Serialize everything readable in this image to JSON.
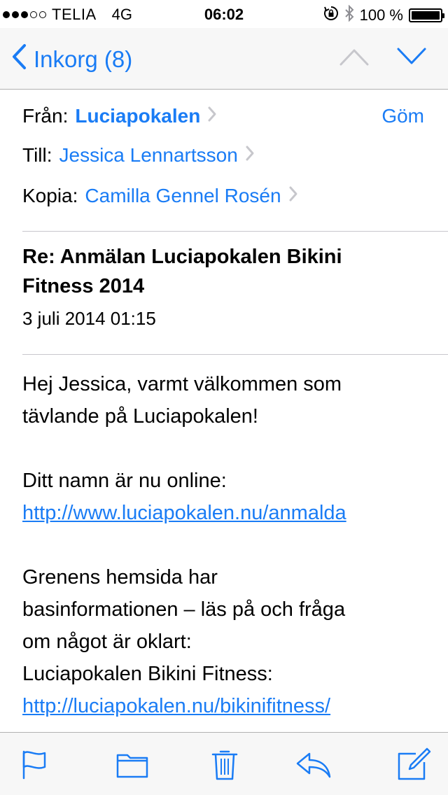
{
  "status": {
    "carrier": "TELIA",
    "network": "4G",
    "time": "06:02",
    "battery_text": "100 %",
    "signal_filled": 3,
    "signal_total": 5,
    "battery_level": 1.0
  },
  "nav": {
    "back_label": "Inkorg (8)",
    "accent_color": "#1a7cf5",
    "icons": [
      "back-chevron-icon",
      "previous-message-icon",
      "next-message-icon"
    ]
  },
  "email": {
    "from_label": "Från:",
    "from_value": "Luciapokalen",
    "hide_label": "Göm",
    "to_label": "Till:",
    "to_value": "Jessica Lennartsson",
    "cc_label": "Kopia:",
    "cc_value": "Camilla Gennel Rosén",
    "subject_line1": "Re: Anmälan Luciapokalen Bikini",
    "subject_line2": "Fitness 2014",
    "date": "3 juli 2014 01:15"
  },
  "body": {
    "p1_line1": "Hej Jessica, varmt välkommen som",
    "p1_line2": "tävlande på Luciapokalen!",
    "p2_line1": "Ditt namn är nu online:",
    "p2_link": "http://www.luciapokalen.nu/anmalda",
    "p3_line1": "Grenens hemsida har",
    "p3_line2": "basinformationen – läs på och fråga",
    "p3_line3": "om något är oklart:",
    "p3_line4": "Luciapokalen Bikini Fitness:",
    "p3_link": "http://luciapokalen.nu/bikinifitness/"
  },
  "toolbar": {
    "icons": [
      "flag-icon",
      "folder-icon",
      "trash-icon",
      "reply-icon",
      "compose-icon"
    ]
  }
}
